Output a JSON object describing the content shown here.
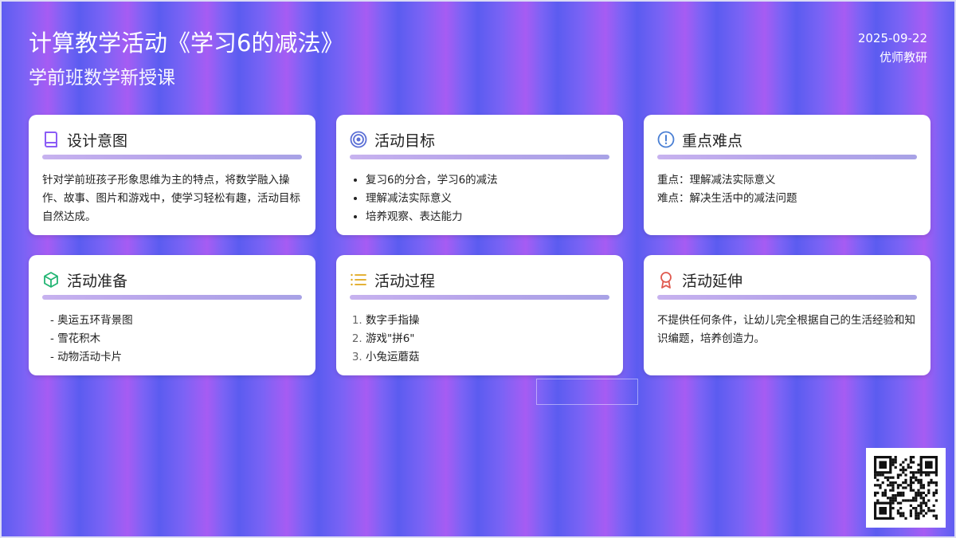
{
  "header": {
    "title": "计算教学活动《学习6的减法》",
    "subtitle": "学前班数学新授课",
    "date": "2025-09-22",
    "author": "优师教研"
  },
  "cards": {
    "design": {
      "title": "设计意图",
      "icon": "book-icon",
      "text": "针对学前班孩子形象思维为主的特点，将数学融入操作、故事、图片和游戏中，使学习轻松有趣，活动目标自然达成。"
    },
    "goals": {
      "title": "活动目标",
      "icon": "target-icon",
      "items": [
        "复习6的分合，学习6的减法",
        "理解减法实际意义",
        "培养观察、表达能力"
      ]
    },
    "keypoints": {
      "title": "重点难点",
      "icon": "alert-circle-icon",
      "lines": [
        "重点：理解减法实际意义",
        "难点：解决生活中的减法问题"
      ]
    },
    "prep": {
      "title": "活动准备",
      "icon": "cube-icon",
      "items": [
        "- 奥运五环背景图",
        "- 雪花积木",
        "- 动物活动卡片"
      ]
    },
    "process": {
      "title": "活动过程",
      "icon": "list-icon",
      "items": [
        "数字手指操",
        "游戏\"拼6\"",
        "小兔运蘑菇"
      ]
    },
    "extension": {
      "title": "活动延伸",
      "icon": "award-icon",
      "text": "不提供任何条件，让幼儿完全根据自己的生活经验和知识编题，培养创造力。"
    }
  },
  "colors": {
    "accent_purple": "#8b5cf6",
    "accent_blue": "#4a7fd4",
    "accent_green": "#22b573",
    "accent_yellow": "#e0a81c",
    "accent_red": "#e05a4f"
  }
}
